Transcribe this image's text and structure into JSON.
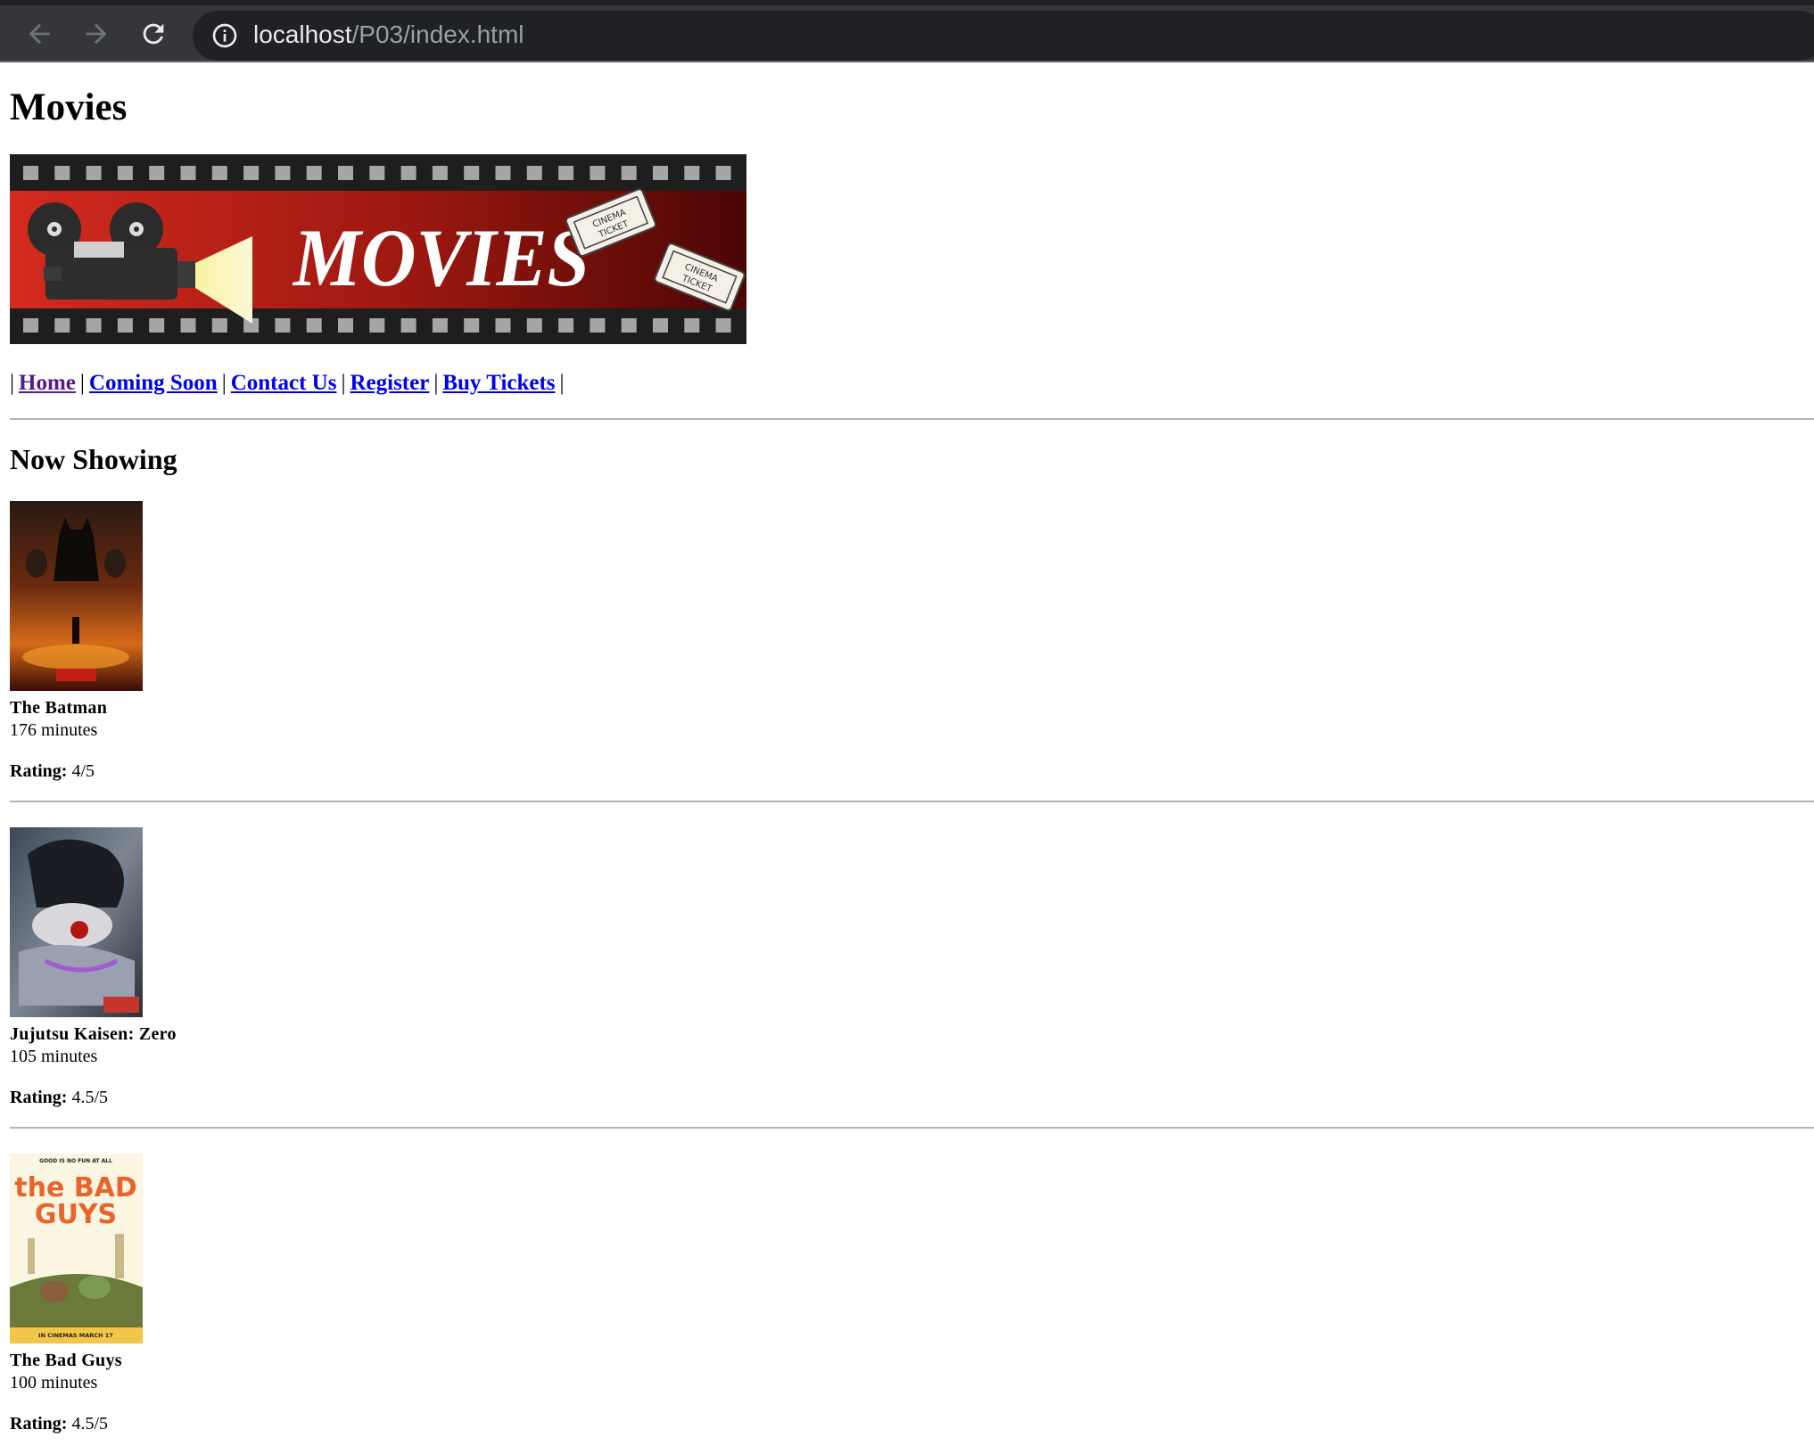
{
  "browser": {
    "url_host": "localhost",
    "url_path": "/P03/index.html"
  },
  "page": {
    "title": "Movies",
    "banner": {
      "text": "MOVIES",
      "ticket_text_1": "CINEMA",
      "ticket_text_2": "TICKET"
    },
    "nav": {
      "separator": "|",
      "links": [
        "Home",
        "Coming Soon",
        "Contact Us",
        "Register",
        "Buy Tickets"
      ]
    },
    "section_heading": "Now Showing",
    "rating_label": "Rating:",
    "movies": [
      {
        "title": "The Batman",
        "duration": "176 minutes",
        "rating": "4/5"
      },
      {
        "title": "Jujutsu Kaisen: Zero",
        "duration": "105 minutes",
        "rating": "4.5/5"
      },
      {
        "title": "The Bad Guys",
        "duration": "100 minutes",
        "rating": "4.5/5",
        "poster_tagline": "GOOD IS NO FUN AT ALL",
        "poster_title_1": "the BAD",
        "poster_title_2": "GUYS",
        "poster_footer": "IN CINEMAS MARCH 17"
      }
    ]
  },
  "colors": {
    "link": "#0000ee",
    "link_visited": "#551a8b",
    "banner_red": "#c0261e",
    "chrome_dark": "#35363a"
  }
}
